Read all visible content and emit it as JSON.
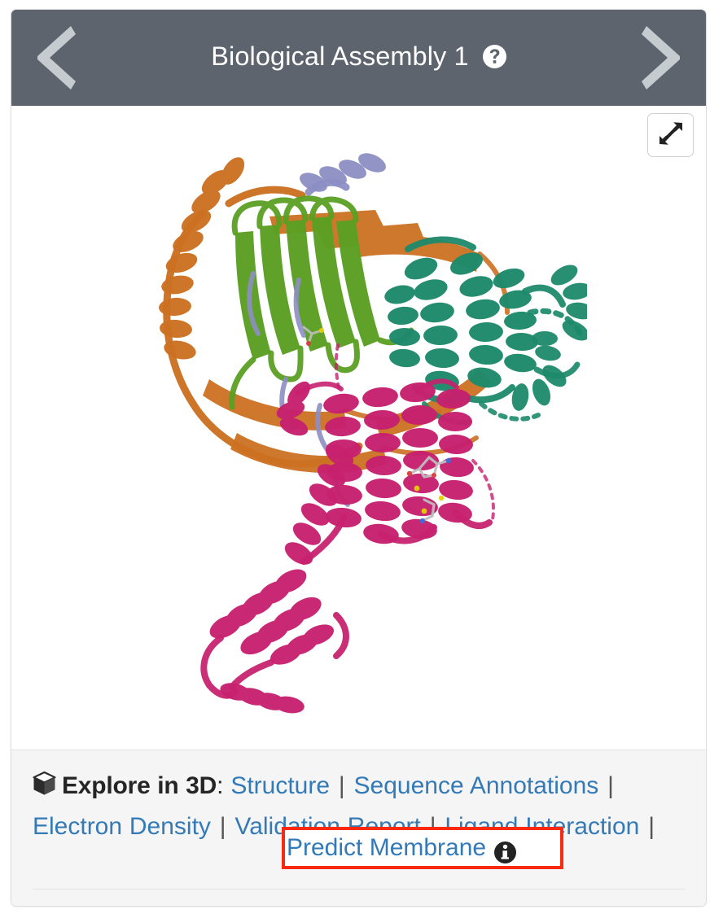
{
  "panel": {
    "header": {
      "title": "Biological Assembly 1",
      "help_icon": "question-circle-icon",
      "prev_icon": "chevron-left-icon",
      "next_icon": "chevron-right-icon",
      "background_color": "#5d646e",
      "title_color": "#ffffff",
      "chevron_color": "#c6cbd0"
    },
    "viewer": {
      "expand_icon": "expand-arrows-icon",
      "background_color": "#ffffff",
      "content_description": "3D ribbon rendering of a biological assembly",
      "chain_colors": {
        "orange": "#cc7122",
        "green": "#5ba023",
        "periwinkle": "#8d8fc4",
        "teal": "#1d8a6b",
        "magenta": "#c7216f"
      }
    },
    "footer": {
      "cube_icon": "cube-3d-icon",
      "explore_label": "Explore in 3D",
      "explore_colon": ":",
      "separator": "|",
      "links": [
        {
          "label": "Structure"
        },
        {
          "label": "Sequence Annotations"
        },
        {
          "label": "Electron Density"
        },
        {
          "label": "Validation Report"
        },
        {
          "label": "Ligand Interaction"
        },
        {
          "label": "Predict Membrane"
        }
      ],
      "info_icon": "info-circle-icon",
      "link_color": "#337ab7",
      "background_color": "#f5f5f5",
      "highlight_color": "#f92a10",
      "highlighted_link": "Predict Membrane"
    }
  }
}
